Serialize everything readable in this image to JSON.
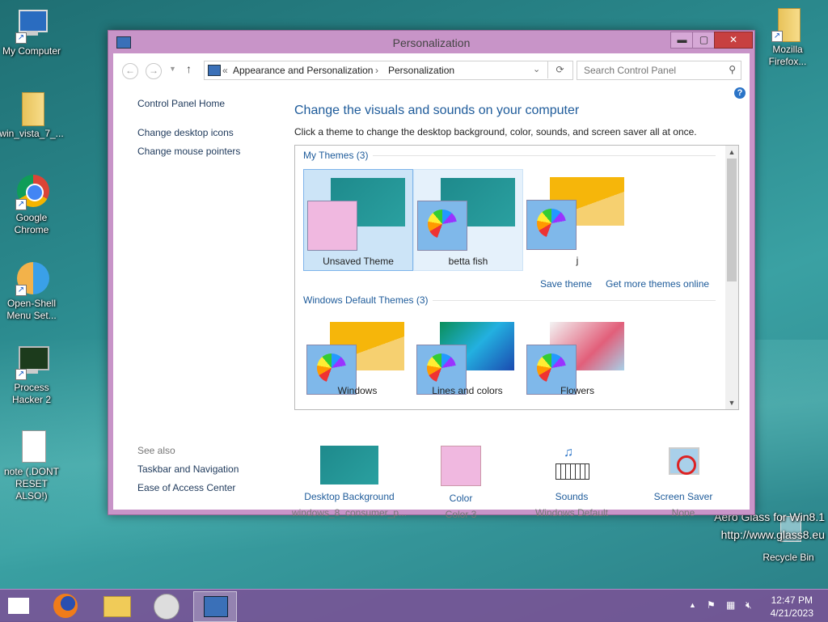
{
  "desktop": {
    "icons": [
      {
        "label": "My Computer"
      },
      {
        "label": "win_vista_7_..."
      },
      {
        "label": "Google Chrome"
      },
      {
        "label": "Open-Shell Menu Set..."
      },
      {
        "label": "Process Hacker 2"
      },
      {
        "label": "note (.DONT RESET ALSO!)"
      },
      {
        "label": "Mozilla Firefox..."
      },
      {
        "label": "Recycle Bin"
      }
    ],
    "watermark_line1": "Aero Glass for Win8.1",
    "watermark_line2": "http://www.glass8.eu"
  },
  "window": {
    "title": "Personalization",
    "buttons": {
      "minimize": "▬",
      "maximize": "▢",
      "close": "✕"
    },
    "address": {
      "prefix": "«",
      "crumb1": "Appearance and Personalization",
      "separator": "›",
      "crumb2": "Personalization"
    },
    "search_placeholder": "Search Control Panel",
    "help": "?"
  },
  "left_pane": {
    "home": "Control Panel Home",
    "links": [
      "Change desktop icons",
      "Change mouse pointers"
    ],
    "see_also_header": "See also",
    "see_also": [
      "Taskbar and Navigation",
      "Ease of Access Center"
    ]
  },
  "main": {
    "heading": "Change the visuals and sounds on your computer",
    "subheading": "Click a theme to change the desktop background, color, sounds, and screen saver all at once.",
    "my_themes_header": "My Themes (3)",
    "my_themes": [
      {
        "label": "Unsaved Theme",
        "state": "selected"
      },
      {
        "label": "betta fish",
        "state": "hover"
      },
      {
        "label": "j",
        "state": "normal"
      }
    ],
    "save_theme": "Save theme",
    "get_more": "Get more themes online",
    "default_header": "Windows Default Themes (3)",
    "default_themes": [
      {
        "label": "Windows"
      },
      {
        "label": "Lines and colors"
      },
      {
        "label": "Flowers"
      }
    ]
  },
  "bottom": [
    {
      "title": "Desktop Background",
      "value": "windows_8_consumer_p..."
    },
    {
      "title": "Color",
      "value": "Color 3"
    },
    {
      "title": "Sounds",
      "value": "Windows Default"
    },
    {
      "title": "Screen Saver",
      "value": "None"
    }
  ],
  "taskbar": {
    "time": "12:47 PM",
    "date": "4/21/2023",
    "tray_up": "▲"
  },
  "colors": {
    "window_frame": "#c894c8",
    "link_blue": "#1e5b9a",
    "taskbar": "#7d5096"
  }
}
